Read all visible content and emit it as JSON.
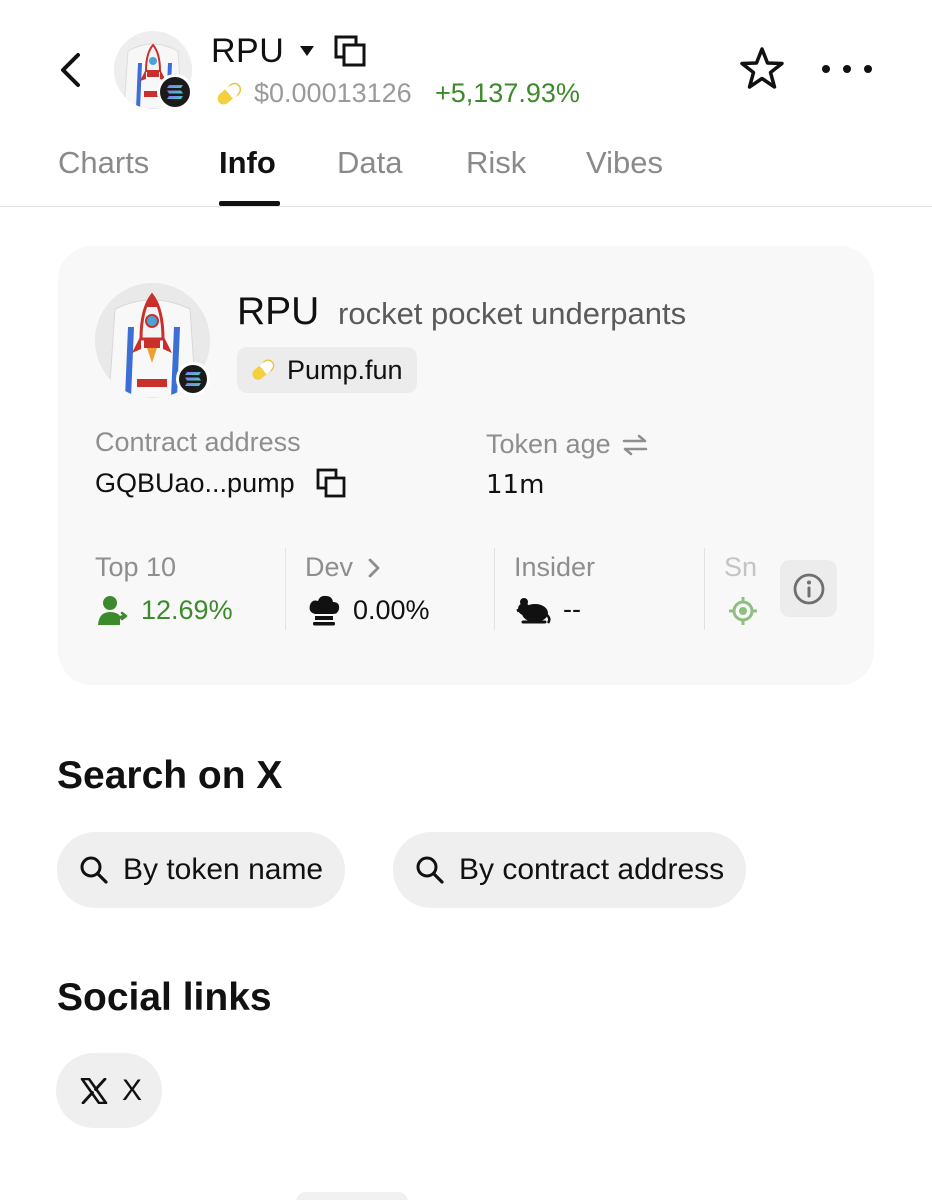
{
  "header": {
    "back_icon": "chevron-left-icon",
    "symbol": "RPU",
    "price": "$0.00013126",
    "change": "+5,137.93%",
    "change_color": "#3d8a2c",
    "platform_icon": "pill-icon"
  },
  "tabs": [
    {
      "label": "Charts",
      "active": false
    },
    {
      "label": "Info",
      "active": true
    },
    {
      "label": "Data",
      "active": false
    },
    {
      "label": "Risk",
      "active": false
    },
    {
      "label": "Vibes",
      "active": false
    }
  ],
  "token_card": {
    "symbol": "RPU",
    "name": "rocket pocket underpants",
    "platform": "Pump.fun",
    "contract_label": "Contract address",
    "contract_value": "GQBUao...pump",
    "age_label": "Token age",
    "age_value": "11m",
    "stats": [
      {
        "label": "Top 10",
        "value": "12.69%",
        "value_color": "#3d8a2c",
        "icon": "user-share-icon"
      },
      {
        "label": "Dev",
        "value": "0.00%",
        "value_color": "#111111",
        "icon": "chef-hat-icon"
      },
      {
        "label": "Insider",
        "value": "--",
        "value_color": "#111111",
        "icon": "rat-icon"
      },
      {
        "label": "Sn",
        "value": "",
        "value_color": "#3d8a2c",
        "icon": "crosshair-icon"
      }
    ]
  },
  "search_section": {
    "title": "Search on X",
    "by_name": "By token name",
    "by_contract": "By contract address"
  },
  "social_section": {
    "title": "Social links",
    "x_label": "X"
  }
}
